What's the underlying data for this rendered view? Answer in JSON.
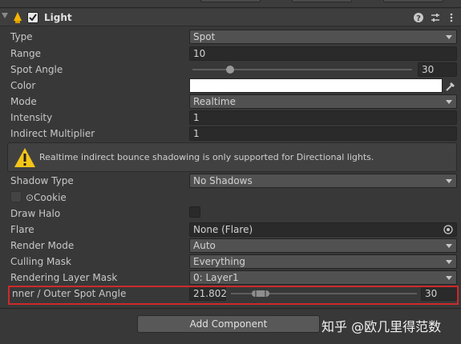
{
  "component": {
    "title": "Light",
    "enabled": true
  },
  "props": {
    "type": {
      "label": "Type",
      "value": "Spot"
    },
    "range": {
      "label": "Range",
      "value": "10"
    },
    "spot_angle": {
      "label": "Spot Angle",
      "value": "30",
      "slider_fraction": 0.17
    },
    "color": {
      "label": "Color",
      "value": "#ffffff"
    },
    "mode": {
      "label": "Mode",
      "value": "Realtime"
    },
    "intensity": {
      "label": "Intensity",
      "value": "1"
    },
    "indirect_multiplier": {
      "label": "Indirect Multiplier",
      "value": "1"
    },
    "shadow_type": {
      "label": "Shadow Type",
      "value": "No Shadows"
    },
    "cookie": {
      "label": "⊙Cookie"
    },
    "draw_halo": {
      "label": "Draw Halo"
    },
    "flare": {
      "label": "Flare",
      "value": "None (Flare)"
    },
    "render_mode": {
      "label": "Render Mode",
      "value": "Auto"
    },
    "culling_mask": {
      "label": "Culling Mask",
      "value": "Everything"
    },
    "rendering_layer_mask": {
      "label": "Rendering Layer Mask",
      "value": "0: Layer1"
    },
    "inner_outer_spot_angle": {
      "label": "nner / Outer Spot Angle",
      "inner": "21.802",
      "outer": "30"
    }
  },
  "warning": {
    "text": "Realtime indirect bounce shadowing is only supported for Directional lights."
  },
  "add_component_label": "Add Component",
  "watermark": "知乎 @欧几里得范数",
  "colors": {
    "highlight": "#cc2a2a",
    "warning": "#f5c518"
  }
}
